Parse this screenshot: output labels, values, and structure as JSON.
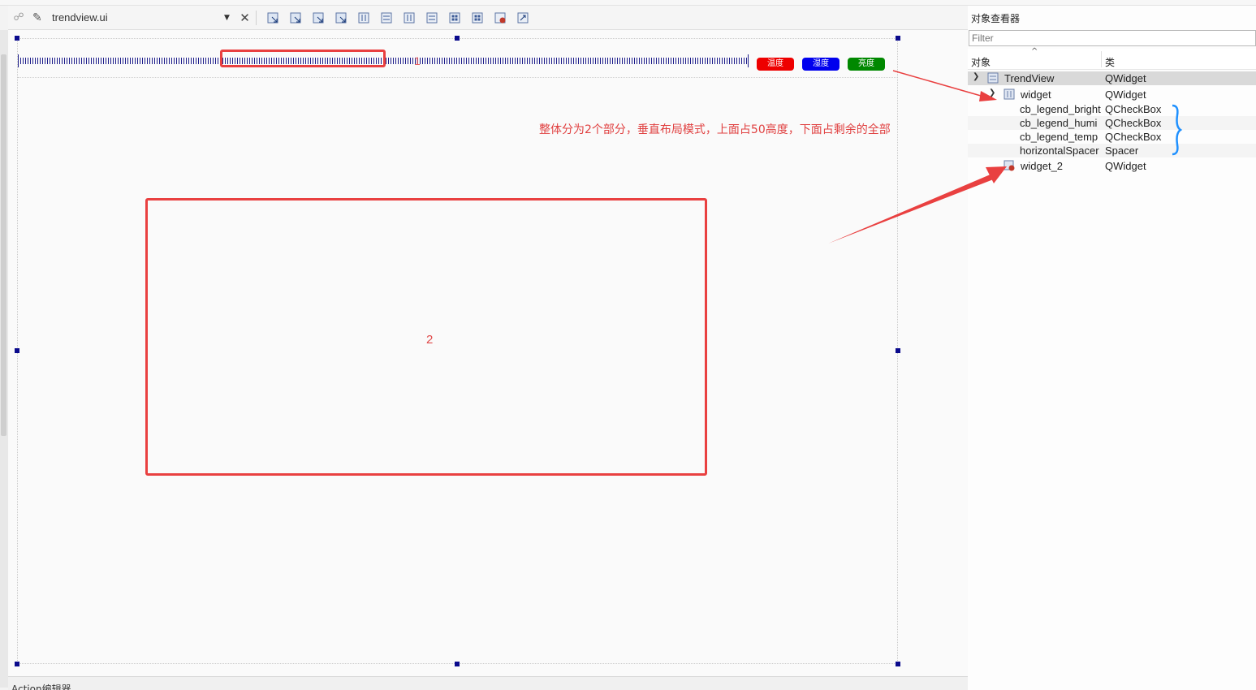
{
  "toolbar": {
    "file_name": "trendview.ui",
    "icons": [
      "edit-widgets-icon",
      "edit-signals-slots-icon",
      "edit-buddies-icon",
      "edit-tab-order-icon",
      "layout-horizontal-icon",
      "layout-vertical-icon",
      "layout-horizontal-splitter-icon",
      "layout-vertical-splitter-icon",
      "layout-form-icon",
      "layout-grid-icon",
      "break-layout-icon",
      "adjust-size-icon"
    ]
  },
  "form": {
    "legend_buttons": [
      {
        "label": "温度",
        "color": "#ee0000"
      },
      {
        "label": "湿度",
        "color": "#0000ee"
      },
      {
        "label": "亮度",
        "color": "#008800"
      }
    ],
    "annotation_label_1": "1",
    "annotation_label_2": "2",
    "annotation_note": "整体分为2个部分，垂直布局模式，上面占50高度，下面占剩余的全部",
    "annotation_color": "#e94040"
  },
  "action_editor": {
    "title": "Action编辑器"
  },
  "inspector": {
    "title": "对象查看器",
    "filter_placeholder": "Filter",
    "col_object": "对象",
    "col_class": "类",
    "rows": [
      {
        "name": "TrendView",
        "class": "QWidget"
      },
      {
        "name": "widget",
        "class": "QWidget"
      },
      {
        "name": "cb_legend_bright",
        "class": "QCheckBox"
      },
      {
        "name": "cb_legend_humi",
        "class": "QCheckBox"
      },
      {
        "name": "cb_legend_temp",
        "class": "QCheckBox"
      },
      {
        "name": "horizontalSpacer",
        "class": "Spacer"
      },
      {
        "name": "widget_2",
        "class": "QWidget"
      }
    ]
  }
}
